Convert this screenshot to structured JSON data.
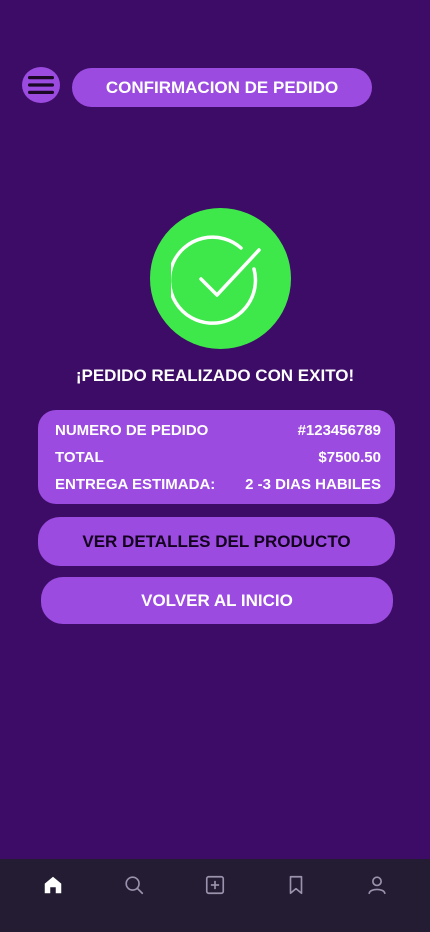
{
  "header": {
    "menu_icon": "hamburger-menu-icon",
    "title": "CONFIRMACION DE PEDIDO"
  },
  "status": {
    "icon": "check-circle-icon",
    "message": "¡PEDIDO REALIZADO CON EXITO!"
  },
  "order": {
    "rows": [
      {
        "label": "NUMERO DE PEDIDO",
        "value": "#123456789"
      },
      {
        "label": "TOTAL",
        "value": "$7500.50"
      },
      {
        "label": "ENTREGA ESTIMADA:",
        "value": "2 -3 DIAS HABILES"
      }
    ]
  },
  "actions": {
    "details_label": "VER DETALLES DEL PRODUCTO",
    "home_label": "VOLVER AL INICIO"
  },
  "nav": {
    "items": [
      {
        "icon": "home-icon",
        "active": true
      },
      {
        "icon": "search-icon",
        "active": false
      },
      {
        "icon": "add-square-icon",
        "active": false
      },
      {
        "icon": "bookmark-icon",
        "active": false
      },
      {
        "icon": "user-icon",
        "active": false
      }
    ]
  },
  "colors": {
    "background": "#3d0c66",
    "accent": "#9b4be0",
    "success": "#3ee84a",
    "nav_background": "#231c33"
  }
}
